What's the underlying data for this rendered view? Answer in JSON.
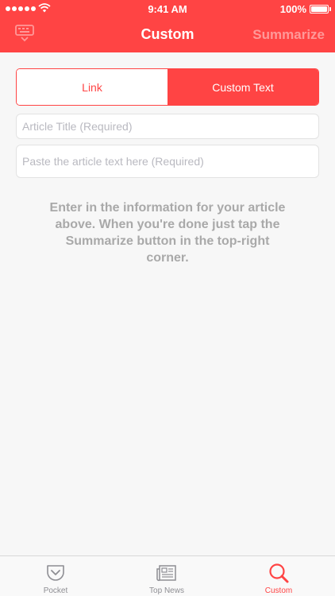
{
  "status_bar": {
    "time": "9:41 AM",
    "battery": "100%"
  },
  "nav": {
    "title": "Custom",
    "action": "Summarize"
  },
  "segmented": {
    "link": "Link",
    "custom": "Custom Text"
  },
  "fields": {
    "title_placeholder": "Article Title (Required)",
    "body_placeholder": "Paste the article text here (Required)"
  },
  "info_text": "Enter in the information for your article above. When you're done just tap the Summarize button in the top-right corner.",
  "tabs": [
    {
      "label": "Pocket",
      "icon": "pocket-icon"
    },
    {
      "label": "Top News",
      "icon": "newspaper-icon"
    },
    {
      "label": "Custom",
      "icon": "search-icon"
    }
  ],
  "colors": {
    "accent": "#ff4444",
    "background": "#f7f7f7",
    "muted": "#a9a9a9"
  }
}
